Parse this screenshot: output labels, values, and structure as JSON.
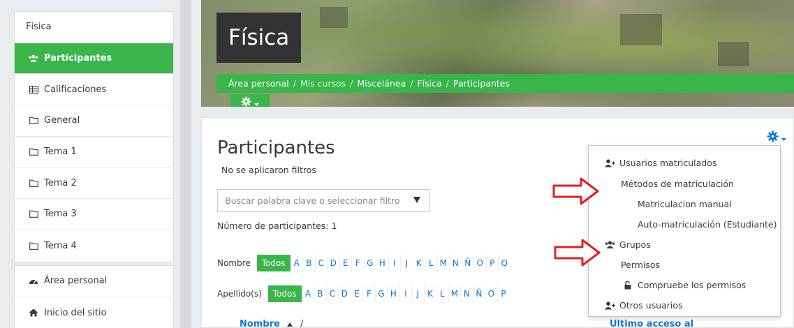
{
  "sidebar": {
    "items": [
      {
        "label": "Física",
        "icon": "none"
      },
      {
        "label": "Participantes",
        "icon": "users-icon",
        "active": true
      },
      {
        "label": "Calificaciones",
        "icon": "table-icon"
      },
      {
        "label": "General",
        "icon": "folder-icon"
      },
      {
        "label": "Tema 1",
        "icon": "folder-icon"
      },
      {
        "label": "Tema 2",
        "icon": "folder-icon"
      },
      {
        "label": "Tema 3",
        "icon": "folder-icon"
      },
      {
        "label": "Tema 4",
        "icon": "folder-icon"
      }
    ],
    "bottom_items": [
      {
        "label": "Área personal",
        "icon": "dashboard-icon"
      },
      {
        "label": "Inicio del sitio",
        "icon": "home-icon"
      }
    ]
  },
  "header": {
    "course_title": "Física",
    "breadcrumb": [
      "Área personal",
      "Mis cursos",
      "Miscelánea",
      "Física",
      "Participantes"
    ]
  },
  "main": {
    "title": "Participantes",
    "no_filters": "No se aplicaron filtros",
    "search_placeholder": "Buscar palabra clave o seleccionar filtro",
    "participant_count": "Número de participantes: 1",
    "first_name_label": "Nombre",
    "last_name_label": "Apellido(s)",
    "all_label": "Todos",
    "letters_row1": [
      "A",
      "B",
      "C",
      "D",
      "E",
      "F",
      "G",
      "H",
      "I",
      "J",
      "K",
      "L",
      "M",
      "N",
      "Ñ",
      "O",
      "P",
      "Q"
    ],
    "letters_row2": [
      "A",
      "B",
      "C",
      "D",
      "E",
      "F",
      "G",
      "H",
      "I",
      "J",
      "K",
      "L",
      "M",
      "N",
      "Ñ",
      "O",
      "P"
    ],
    "col_name": "Nombre",
    "col_name_suffix": "/",
    "col_last_access": "Ultimo acceso al"
  },
  "dropdown": {
    "enrolled_users": "Usuarios matriculados",
    "enrol_methods": "Métodos de matriculación",
    "manual": "Matriculacion manual",
    "self": "Auto-matriculación (Estudiante)",
    "groups": "Grupos",
    "permissions": "Permisos",
    "check_permissions": "Compruebe los permisos",
    "other_users": "Otros usuarios"
  },
  "colors": {
    "brand_green": "#39b54a",
    "link_blue": "#1177d1",
    "arrow_red": "#e02020"
  }
}
